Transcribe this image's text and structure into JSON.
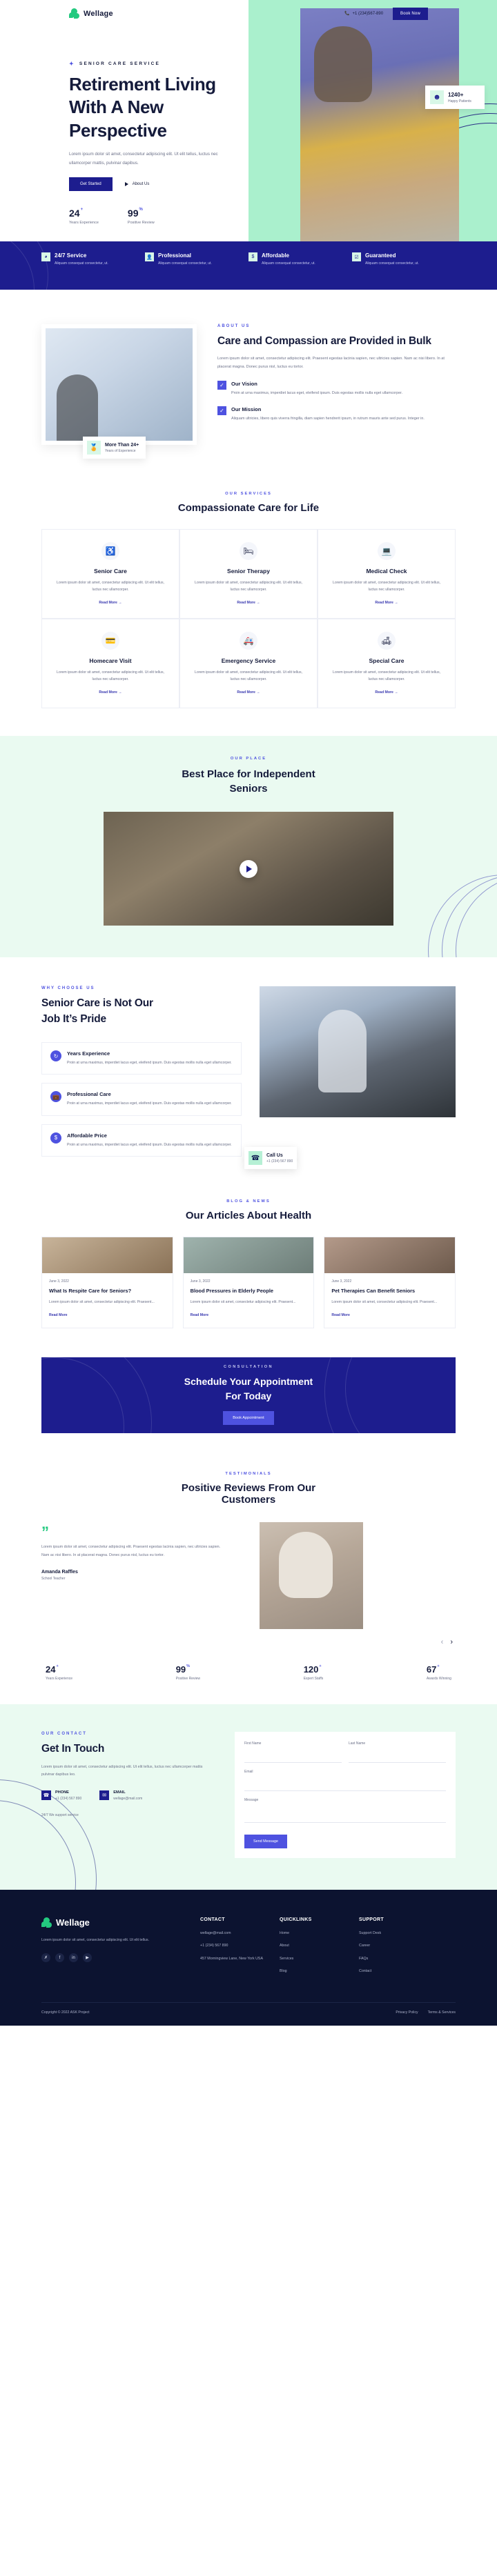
{
  "brand": {
    "name": "Wellage"
  },
  "header": {
    "phone": "+1 (234)567-890",
    "book_label": "Book Now",
    "phone_icon": "phone-icon"
  },
  "hero": {
    "eyebrow": "SENIOR CARE SERVICE",
    "title_line1": "Retirement Living",
    "title_line2": "With A New",
    "title_line3": "Perspective",
    "subtitle": "Lorem ipsum dolor sit amet, consectetur adipiscing elit. Ut elit tellus, luctus nec ullamcorper mattis, pulvinar dapibus.",
    "primary_btn": "Get Started",
    "secondary_btn": "About Us",
    "stats": [
      {
        "value": "24",
        "suffix": "+",
        "label": "Years Experience"
      },
      {
        "value": "99",
        "suffix": "%",
        "label": "Positive Review"
      }
    ],
    "card": {
      "number": "1240+",
      "label": "Happy Patients",
      "icon": "smiley-icon"
    }
  },
  "feature_bar": [
    {
      "icon": "clock-icon",
      "title": "24/7 Service",
      "desc": "Aliquam consequat consectetur, ut."
    },
    {
      "icon": "user-badge-icon",
      "title": "Professional",
      "desc": "Aliquam consequat consectetur, ut."
    },
    {
      "icon": "dollar-icon",
      "title": "Affordable",
      "desc": "Aliquam consequat consectetur, ut."
    },
    {
      "icon": "clipboard-check-icon",
      "title": "Guaranteed",
      "desc": "Aliquam consequat consectetur, ut."
    }
  ],
  "about": {
    "eyebrow": "ABOUT US",
    "title": "Care and Compassion are Provided in Bulk",
    "body": "Lorem ipsum dolor sit amet, consectetur adipiscing elit. Praesent egestas lacinia sapien, nec ultricies sapien. Nam ac nisi libero. In at placerat magna. Donec purus nisl, luctus eu tortor.",
    "badge": {
      "title": "More Than 24+",
      "sub": "Years of Experience",
      "icon": "medal-icon"
    },
    "points": [
      {
        "title": "Our Vision",
        "desc": "Proin at urna maximus, imperdiet lacus eget, eleifend ipsum. Duis egestas mollis nulla eget ullamcorper."
      },
      {
        "title": "Our Mission",
        "desc": "Aliquam ultricies, libero quis viverra fringilla, diam sapien hendrerit ipsum, in rutrum mauris ante sed purus. Integer in."
      }
    ]
  },
  "services": {
    "eyebrow": "OUR SERVICES",
    "title": "Compassionate Care for Life",
    "read_more": "Read More  →",
    "items": [
      {
        "icon": "wheelchair-icon",
        "title": "Senior Care",
        "desc": "Lorem ipsum dolor sit amet, consectetur adipiscing elit. Ut elit tellus, luctus nec ullamcorper."
      },
      {
        "icon": "medical-bed-icon",
        "title": "Senior Therapy",
        "desc": "Lorem ipsum dolor sit amet, consectetur adipiscing elit. Ut elit tellus, luctus nec ullamcorper."
      },
      {
        "icon": "monitor-heartbeat-icon",
        "title": "Medical Check",
        "desc": "Lorem ipsum dolor sit amet, consectetur adipiscing elit. Ut elit tellus, luctus nec ullamcorper."
      },
      {
        "icon": "home-card-icon",
        "title": "Homecare Visit",
        "desc": "Lorem ipsum dolor sit amet, consectetur adipiscing elit. Ut elit tellus, luctus nec ullamcorper."
      },
      {
        "icon": "ambulance-icon",
        "title": "Emergency Service",
        "desc": "Lorem ipsum dolor sit amet, consectetur adipiscing elit. Ut elit tellus, luctus nec ullamcorper."
      },
      {
        "icon": "stretcher-icon",
        "title": "Special Care",
        "desc": "Lorem ipsum dolor sit amet, consectetur adipiscing elit. Ut elit tellus, luctus nec ullamcorper."
      }
    ]
  },
  "video": {
    "eyebrow": "OUR PLACE",
    "title_line1": "Best Place for Independent",
    "title_line2": "Seniors",
    "play_icon": "play-icon"
  },
  "why": {
    "eyebrow": "WHY CHOOSE US",
    "title_line1": "Senior Care is Not Our",
    "title_line2": "Job It’s Pride",
    "items": [
      {
        "icon": "history-clock-icon",
        "title": "Years Experience",
        "desc": "Proin at urna maximus, imperdiet lacus eget, eleifend ipsum. Duis egestas mollis nulla eget ullamcorper."
      },
      {
        "icon": "medical-bag-icon",
        "title": "Professional Care",
        "desc": "Proin at urna maximus, imperdiet lacus eget, eleifend ipsum. Duis egestas mollis nulla eget ullamcorper."
      },
      {
        "icon": "dollar-circle-icon",
        "title": "Affordable Price",
        "desc": "Proin at urna maximus, imperdiet lacus eget, eleifend ipsum. Duis egestas mollis nulla eget ullamcorper."
      }
    ],
    "call_card": {
      "title": "Call Us",
      "number": "+1 (234) 567 890",
      "icon": "phone-icon"
    }
  },
  "blog": {
    "eyebrow": "BLOG & NEWS",
    "title": "Our Articles About Health",
    "read_more": "Read More",
    "posts": [
      {
        "date": "June 3, 2022",
        "title": "What Is Respite Care for Seniors?",
        "excerpt": "Lorem ipsum dolor sit amet, consectetur adipiscing elit. Praesent..."
      },
      {
        "date": "June 3, 2022",
        "title": "Blood Pressures in Elderly People",
        "excerpt": "Lorem ipsum dolor sit amet, consectetur adipiscing elit. Praesent..."
      },
      {
        "date": "June 3, 2022",
        "title": "Pet Therapies Can Benefit Seniors",
        "excerpt": "Lorem ipsum dolor sit amet, consectetur adipiscing elit. Praesent..."
      }
    ]
  },
  "cta": {
    "eyebrow": "CONSULTATION",
    "title_line1": "Schedule Your Appointment",
    "title_line2": "For Today",
    "button": "Book Appointment"
  },
  "testimonials": {
    "eyebrow": "TESTIMONIALS",
    "title_line1": "Positive Reviews From Our",
    "title_line2": "Customers",
    "quote_mark": "”",
    "text": "Lorem ipsum dolor sit amet, consectetur adipiscing elit. Praesent egestas lacinia sapien, nec ultricies sapien. Nam ac nisi libero. In at placerat magna. Donec purus nisl, luctus eu tortor.",
    "name": "Amanda Raffles",
    "role": "School Teacher",
    "prev_icon": "arrow-left-icon",
    "next_icon": "arrow-right-icon",
    "stats": [
      {
        "value": "24",
        "suffix": "+",
        "label": "Years Experience"
      },
      {
        "value": "99",
        "suffix": "%",
        "label": "Positive Review"
      },
      {
        "value": "120",
        "suffix": "+",
        "label": "Expert Staffs"
      },
      {
        "value": "67",
        "suffix": "+",
        "label": "Awards Winning"
      }
    ]
  },
  "contact": {
    "eyebrow": "OUR CONTACT",
    "title": "Get In Touch",
    "text": "Lorem ipsum dolor sit amet, consectetur adipiscing elit. Ut elit tellus, luctus nec ullamcorper mattis pulvinar dapibus leo.",
    "items": [
      {
        "icon": "phone-icon",
        "label": "PHONE",
        "value": "+1 (234) 567 890"
      },
      {
        "icon": "mail-icon",
        "label": "EMAIL",
        "value": "wellage@mail.com"
      }
    ],
    "note": "24/7 We support service",
    "form": {
      "first_name_label": "First Name",
      "first_name_placeholder": "",
      "last_name_label": "Last Name",
      "last_name_placeholder": "",
      "email_label": "Email",
      "email_placeholder": "",
      "message_label": "Message",
      "message_placeholder": "",
      "submit": "Send Message"
    }
  },
  "footer": {
    "desc": "Lorem ipsum dolor sit amet, consectetur adipiscing elit. Ut elit tellus.",
    "social": [
      {
        "icon": "twitter-icon",
        "glyph": "✗"
      },
      {
        "icon": "facebook-icon",
        "glyph": "f"
      },
      {
        "icon": "linkedin-icon",
        "glyph": "in"
      },
      {
        "icon": "youtube-icon",
        "glyph": "▶"
      }
    ],
    "columns": [
      {
        "heading": "CONTACT",
        "items": [
          "wellage@mail.com",
          "+1 (234) 567 890",
          "457 Morningview Lane, New York USA"
        ]
      },
      {
        "heading": "QUICKLINKS",
        "items": [
          "Home",
          "About",
          "Services",
          "Blog"
        ]
      },
      {
        "heading": "SUPPORT",
        "items": [
          "Support Desk",
          "Career",
          "FAQs",
          "Contact"
        ]
      }
    ],
    "copyright": "Copyright © 2022 ASK Project",
    "links": [
      "Privacy Policy",
      "Terms & Services"
    ]
  }
}
